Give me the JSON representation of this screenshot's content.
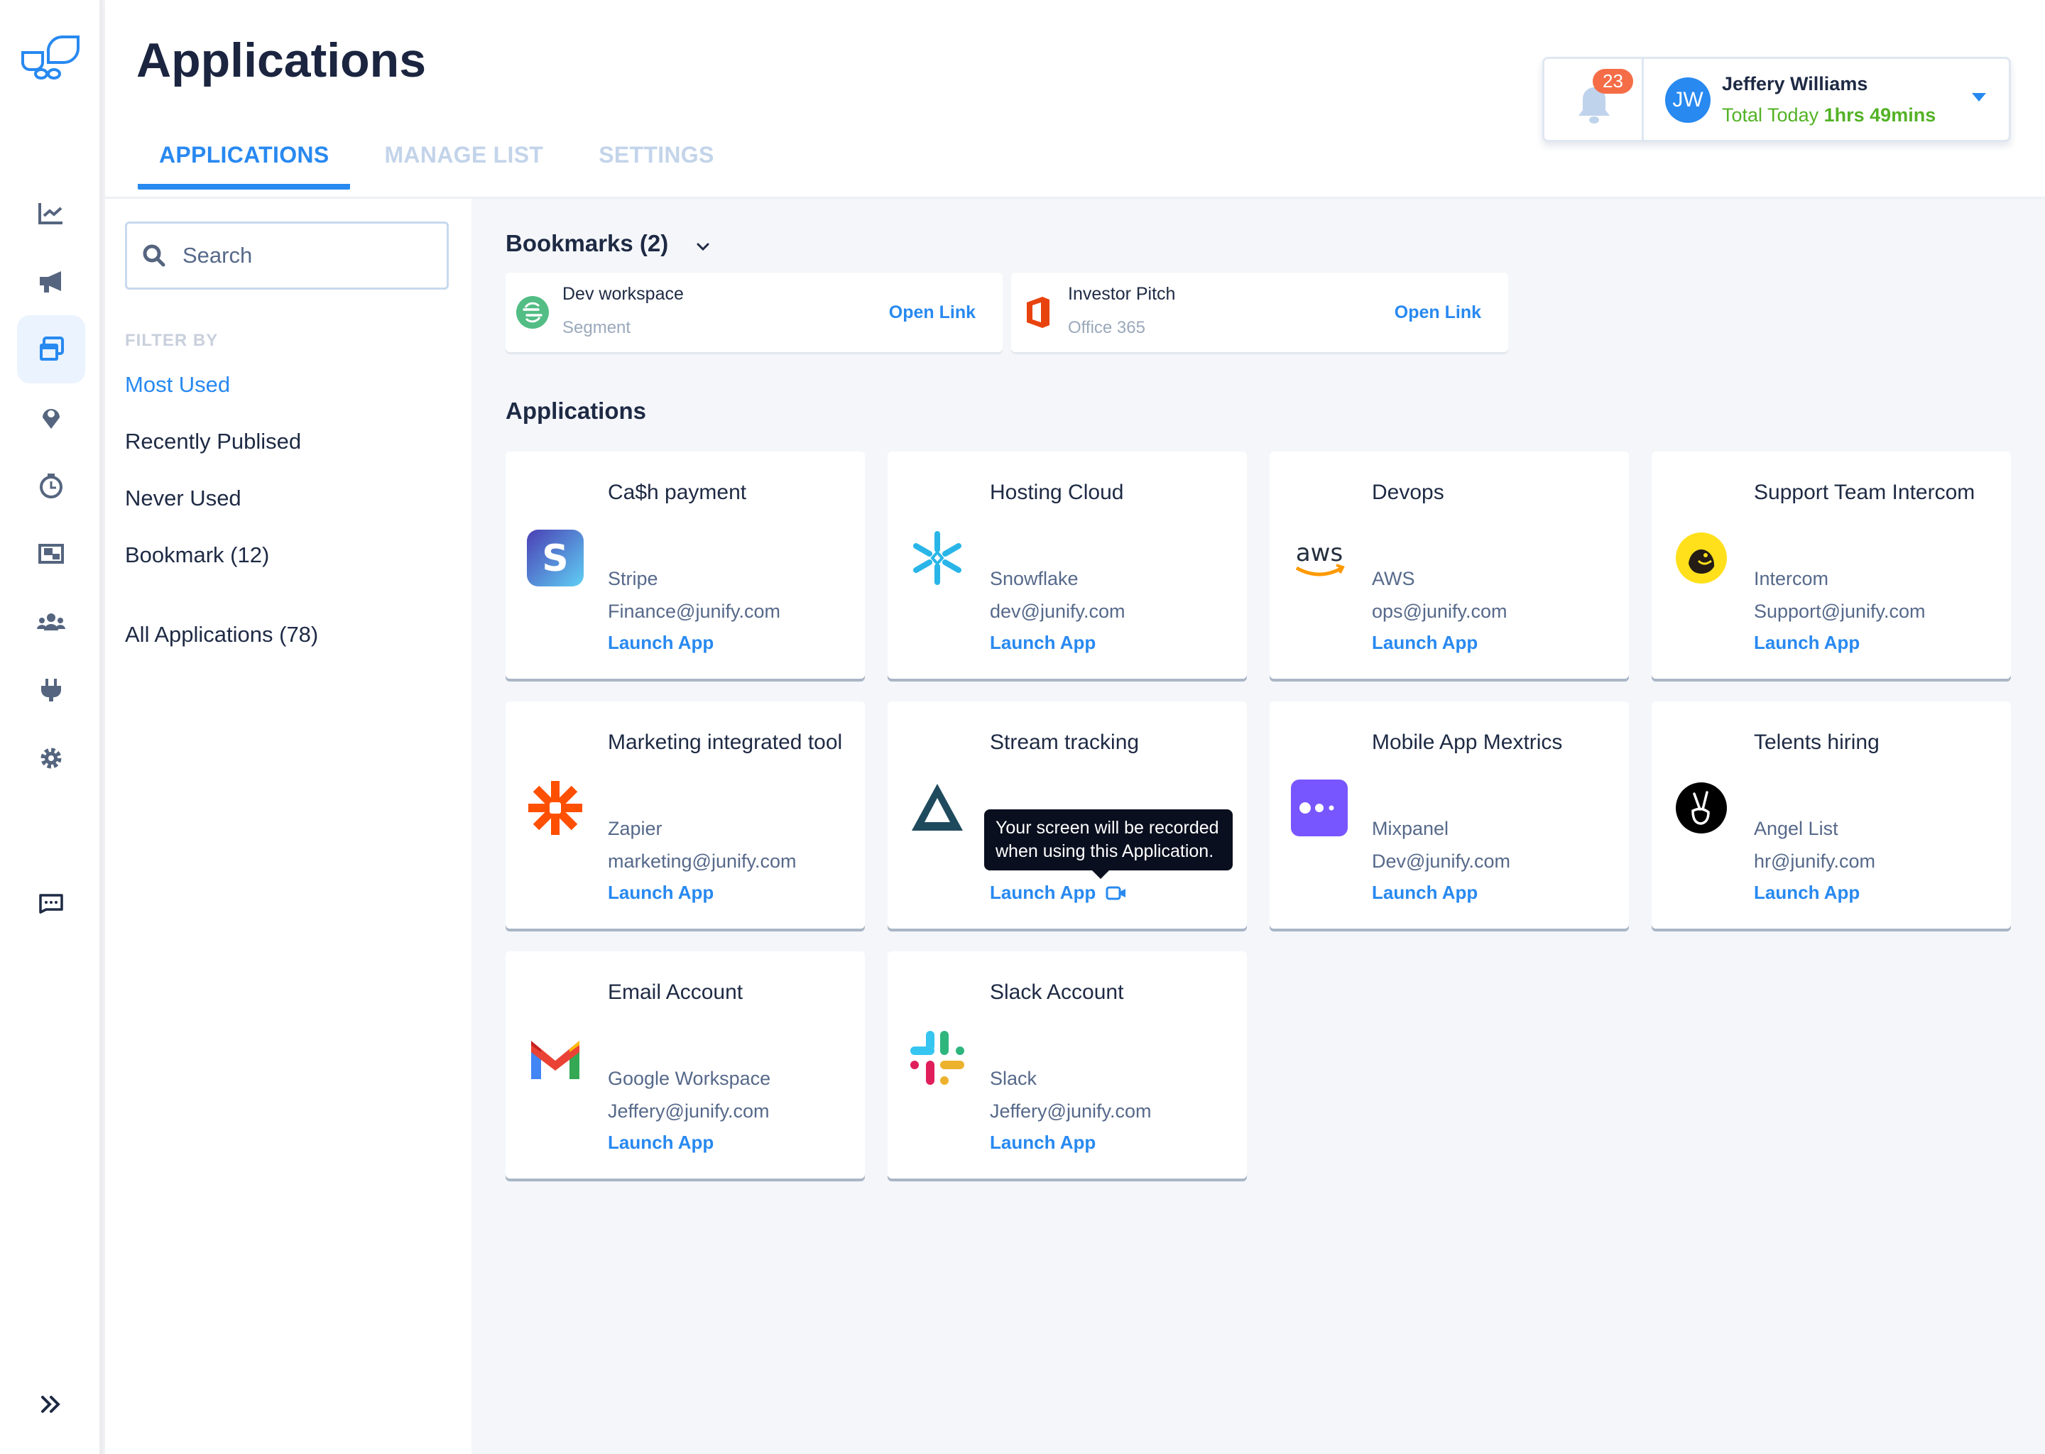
{
  "header": {
    "title": "Applications",
    "tabs": [
      {
        "label": "APPLICATIONS",
        "active": true
      },
      {
        "label": "MANAGE LIST",
        "active": false
      },
      {
        "label": "SETTINGS",
        "active": false
      }
    ]
  },
  "user": {
    "notification_count": "23",
    "initials": "JW",
    "name": "Jeffery Williams",
    "time_label": "Total Today",
    "time_value": "1hrs 49mins"
  },
  "rail": {
    "items": [
      {
        "icon": "chart-line-icon"
      },
      {
        "icon": "megaphone-icon"
      },
      {
        "icon": "windows-icon",
        "active": true
      },
      {
        "icon": "location-pin-icon"
      },
      {
        "icon": "stopwatch-icon"
      },
      {
        "icon": "screens-icon"
      },
      {
        "icon": "users-icon"
      },
      {
        "icon": "plug-icon"
      },
      {
        "icon": "gear-icon"
      },
      {
        "icon": "chat-icon"
      },
      {
        "icon": "expand-icon"
      }
    ]
  },
  "filters": {
    "search_placeholder": "Search",
    "label": "FILTER BY",
    "items": [
      {
        "label": "Most Used",
        "active": true
      },
      {
        "label": "Recently Publised"
      },
      {
        "label": "Never Used"
      },
      {
        "label": "Bookmark (12)"
      },
      {
        "label": "All Applications (78)"
      }
    ]
  },
  "bookmarks": {
    "title": "Bookmarks (2)",
    "items": [
      {
        "title": "Dev workspace",
        "vendor": "Segment",
        "link": "Open Link",
        "icon": "segment-logo-icon"
      },
      {
        "title": "Investor Pitch",
        "vendor": "Office 365",
        "link": "Open Link",
        "icon": "office365-logo-icon"
      }
    ]
  },
  "applications": {
    "title": "Applications",
    "launch_label": "Launch App",
    "items": [
      {
        "title": "Ca$h payment",
        "vendor": "Stripe",
        "email": "Finance@junify.com",
        "icon": "stripe-logo-icon"
      },
      {
        "title": "Hosting Cloud",
        "vendor": "Snowflake",
        "email": "dev@junify.com",
        "icon": "snowflake-logo-icon"
      },
      {
        "title": "Devops",
        "vendor": "AWS",
        "email": "ops@junify.com",
        "icon": "aws-logo-icon"
      },
      {
        "title": "Support Team Intercom",
        "vendor": "Intercom",
        "email": "Support@junify.com",
        "icon": "mailchimp-logo-icon"
      },
      {
        "title": "Marketing integrated tool",
        "vendor": "Zapier",
        "email": "marketing@junify.com",
        "icon": "zapier-logo-icon"
      },
      {
        "title": "Stream tracking",
        "vendor": "",
        "email": "",
        "icon": "triangle-logo-icon",
        "recorded": true
      },
      {
        "title": "Mobile App Mextrics",
        "vendor": "Mixpanel",
        "email": "Dev@junify.com",
        "icon": "mixpanel-logo-icon"
      },
      {
        "title": "Telents hiring",
        "vendor": "Angel List",
        "email": "hr@junify.com",
        "icon": "angellist-logo-icon"
      },
      {
        "title": "Email Account",
        "vendor": "Google Workspace",
        "email": "Jeffery@junify.com",
        "icon": "gmail-logo-icon"
      },
      {
        "title": "Slack Account",
        "vendor": "Slack",
        "email": "Jeffery@junify.com",
        "icon": "slack-logo-icon"
      }
    ],
    "tooltip": "Your screen will be recorded when using this Application."
  },
  "colors": {
    "accent": "#2889f0",
    "text_dark": "#1e2a44",
    "text_muted": "#56698a",
    "success": "#53b225",
    "badge": "#f46d47",
    "background": "#f4f6fa"
  }
}
